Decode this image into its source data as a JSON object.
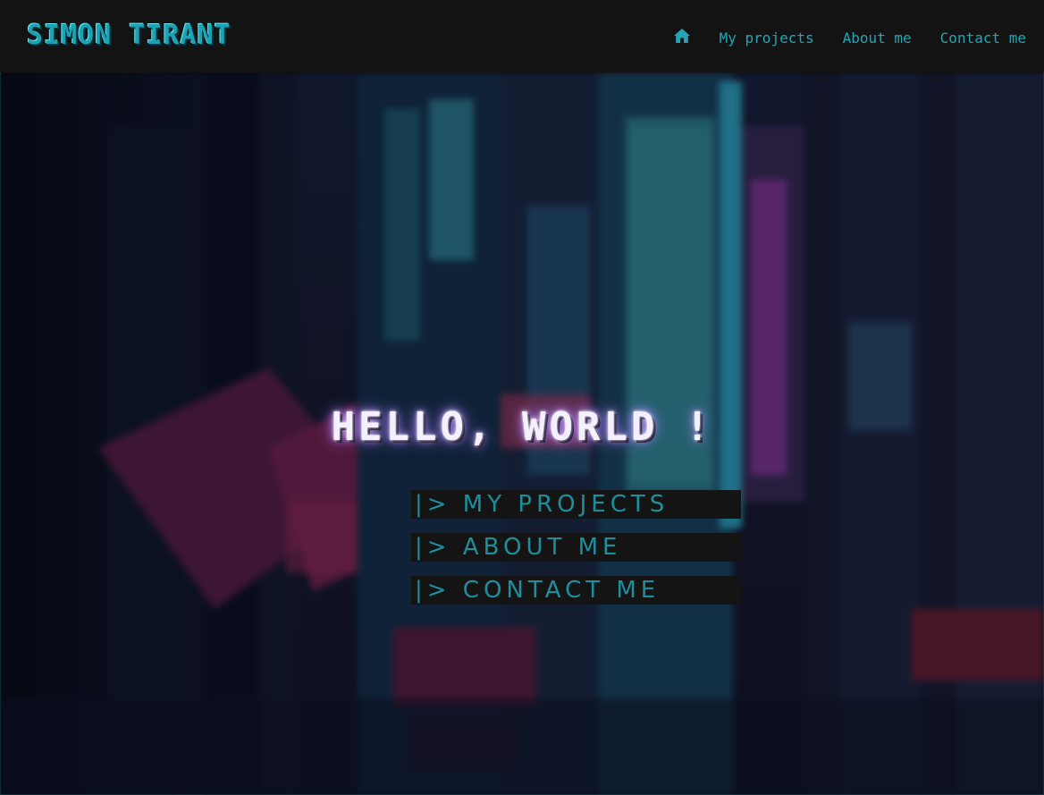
{
  "header": {
    "brand": "SIMON TIRANT",
    "nav": {
      "home_icon": "home-icon",
      "links": [
        "My projects",
        "About me",
        "Contact me"
      ]
    }
  },
  "hero": {
    "title": "HELLO, WORLD !",
    "menu": [
      "|> MY PROJECTS",
      "|> ABOUT ME",
      "|> CONTACT ME"
    ]
  },
  "colors": {
    "accent": "#1aa3b5",
    "nav_bg": "#131313",
    "menu_bg": "#141414",
    "menu_text": "#1d8f9c"
  }
}
